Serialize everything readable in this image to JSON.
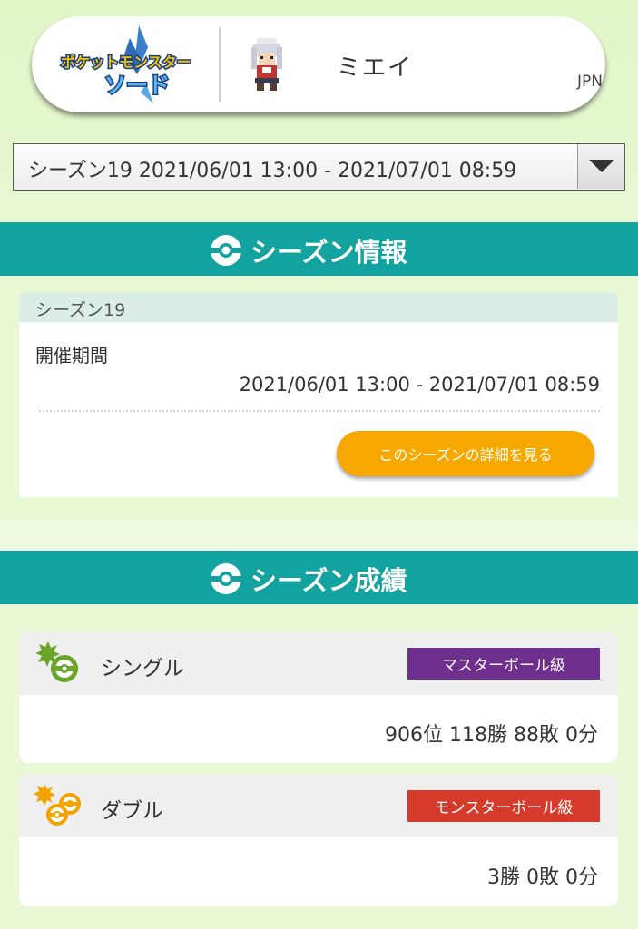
{
  "header": {
    "logo_text_line1": "ポケットモンスター",
    "logo_text_line2": "ソード",
    "trainer_name": "ミエイ",
    "region": "JPN",
    "avatar_icon": "trainer-sprite-icon"
  },
  "season_select": {
    "selected": "シーズン19 2021/06/01 13:00 - 2021/07/01 08:59",
    "arrow_icon": "caret-down-icon"
  },
  "season_info": {
    "section_title": "シーズン情報",
    "season_name": "シーズン19",
    "period_label": "開催期間",
    "period_value": "2021/06/01 13:00 - 2021/07/01 08:59",
    "detail_button": "このシーズンの詳細を見る"
  },
  "season_results": {
    "section_title": "シーズン成績",
    "single": {
      "label": "シングル",
      "rank": "マスターボール級",
      "rank_color": "#6f2f8f",
      "record": "906位 118勝 88敗 0分"
    },
    "double": {
      "label": "ダブル",
      "rank": "モンスターボール級",
      "rank_color": "#d63a2a",
      "record": "3勝 0敗 0分"
    }
  },
  "colors": {
    "band": "#12a3a0",
    "accent_button": "#f6a800",
    "background": "#e6f6d0"
  }
}
